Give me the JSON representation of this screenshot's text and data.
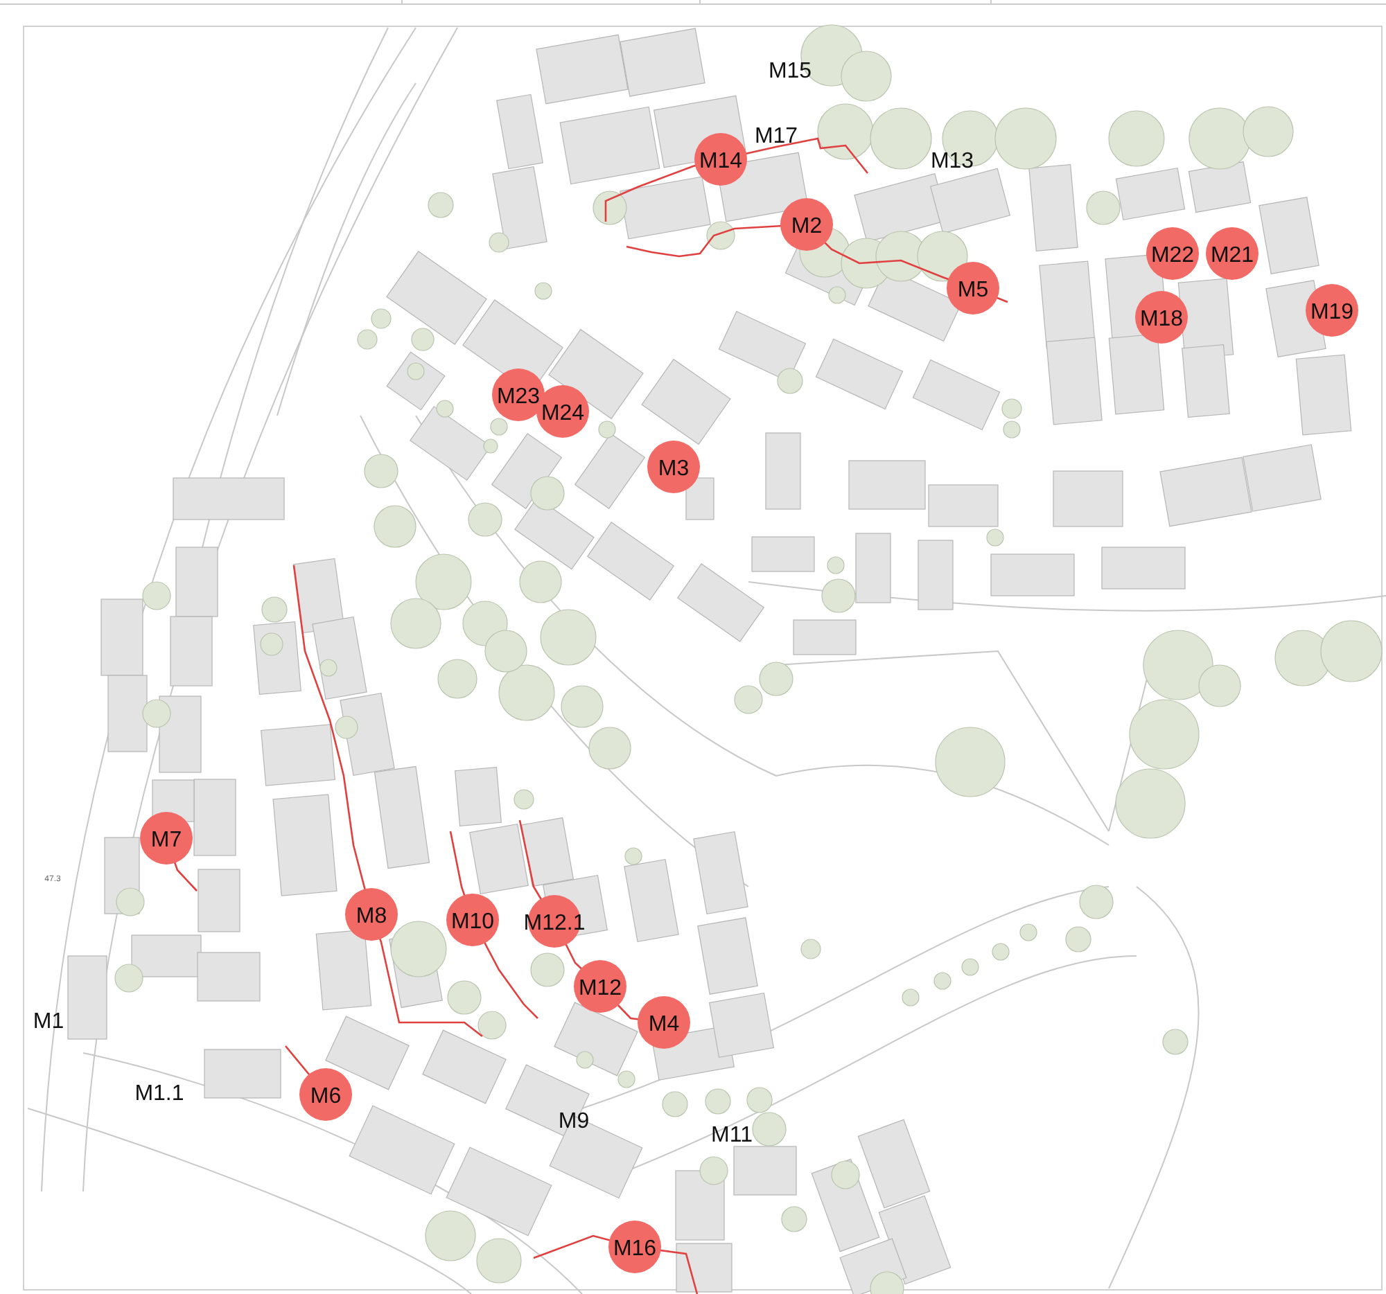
{
  "map": {
    "elevation_label": "47.3",
    "markers": [
      {
        "label": "M15",
        "kind": "label"
      },
      {
        "label": "M17",
        "kind": "label"
      },
      {
        "label": "M14",
        "kind": "marker"
      },
      {
        "label": "M13",
        "kind": "label"
      },
      {
        "label": "M2",
        "kind": "marker"
      },
      {
        "label": "M22",
        "kind": "marker"
      },
      {
        "label": "M21",
        "kind": "marker"
      },
      {
        "label": "M5",
        "kind": "marker"
      },
      {
        "label": "M19",
        "kind": "marker"
      },
      {
        "label": "M18",
        "kind": "marker"
      },
      {
        "label": "M23",
        "kind": "marker"
      },
      {
        "label": "M24",
        "kind": "marker"
      },
      {
        "label": "M3",
        "kind": "marker"
      },
      {
        "label": "M7",
        "kind": "marker"
      },
      {
        "label": "M8",
        "kind": "marker"
      },
      {
        "label": "M10",
        "kind": "marker"
      },
      {
        "label": "M12.1",
        "kind": "marker"
      },
      {
        "label": "M12",
        "kind": "marker"
      },
      {
        "label": "M1",
        "kind": "label"
      },
      {
        "label": "M4",
        "kind": "marker"
      },
      {
        "label": "M1.1",
        "kind": "label"
      },
      {
        "label": "M6",
        "kind": "marker"
      },
      {
        "label": "M9",
        "kind": "label"
      },
      {
        "label": "M11",
        "kind": "label"
      },
      {
        "label": "M16",
        "kind": "marker"
      }
    ]
  }
}
